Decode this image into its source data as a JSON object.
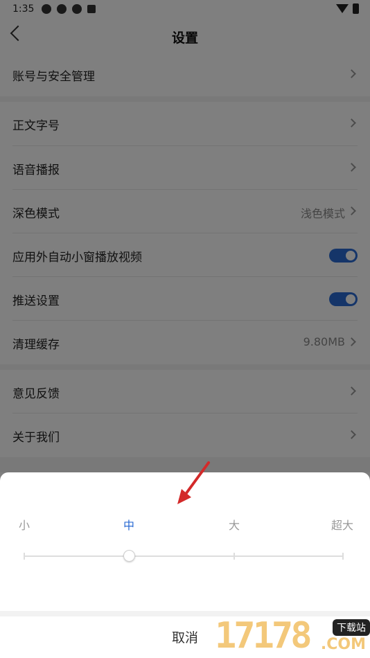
{
  "status_bar": {
    "time": "1:35"
  },
  "header": {
    "title": "设置"
  },
  "settings": {
    "account": {
      "label": "账号与安全管理"
    },
    "font_size": {
      "label": "正文字号"
    },
    "voice": {
      "label": "语音播报"
    },
    "dark_mode": {
      "label": "深色模式",
      "value": "浅色模式"
    },
    "pip": {
      "label": "应用外自动小窗播放视频",
      "enabled": true
    },
    "push": {
      "label": "推送设置",
      "enabled": true
    },
    "cache": {
      "label": "清理缓存",
      "value": "9.80MB"
    },
    "feedback": {
      "label": "意见反馈"
    },
    "about": {
      "label": "关于我们"
    }
  },
  "font_sheet": {
    "options": [
      "小",
      "中",
      "大",
      "超大"
    ],
    "selected": "中",
    "cancel_label": "取消"
  },
  "watermark": {
    "digits": "17178",
    "tag": "下载站",
    "suffix": ".COM"
  },
  "colors": {
    "accent": "#2a6ad3",
    "annotation_arrow": "#d32a2a"
  }
}
